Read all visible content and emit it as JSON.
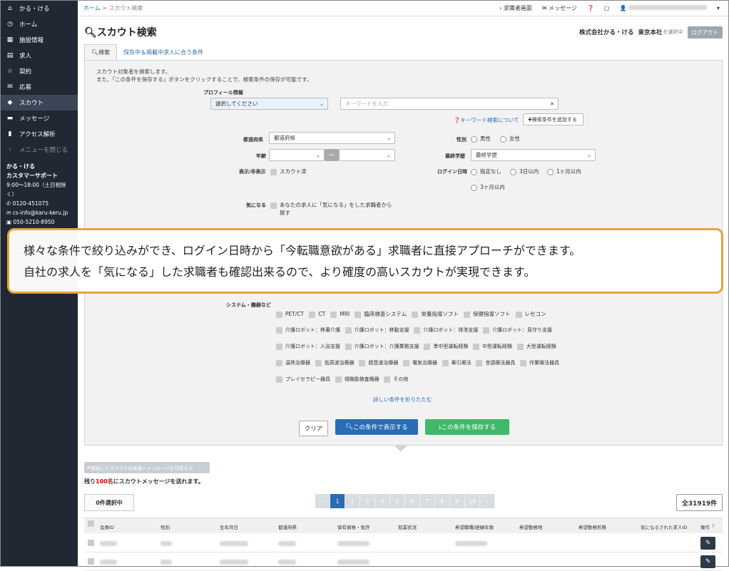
{
  "sidebar": {
    "brand": "かる・ける",
    "items": [
      {
        "label": "ホーム",
        "icon": "clock-icon"
      },
      {
        "label": "施設情報",
        "icon": "grid-icon"
      },
      {
        "label": "求人",
        "icon": "list-icon"
      },
      {
        "label": "契約",
        "icon": "star-icon"
      },
      {
        "label": "応募",
        "icon": "mail-icon"
      },
      {
        "label": "スカウト",
        "icon": "diamond-icon"
      },
      {
        "label": "メッセージ",
        "icon": "chat-icon"
      },
      {
        "label": "アクセス解析",
        "icon": "bar-chart-icon"
      }
    ],
    "close_menu": "メニューを閉じる",
    "support_title": "かる・ける\nカスタマーサポート",
    "support_title1": "かる・ける",
    "support_title2": "カスタマーサポート",
    "support_hours": "9:00～18:00（土日祝除く）",
    "phone": "0120-451075",
    "email": "cs-info@karu-keru.jp",
    "fax": "050-5210-8950"
  },
  "topbar": {
    "crumb_home": "ホーム",
    "crumb_sep": ">",
    "crumb_current": "スカウト検索",
    "jobseeker_screen": "求職者画面",
    "message": "メッセージ"
  },
  "header": {
    "title": "スカウト検索",
    "company": "株式会社かる・ける",
    "branch": "東京本社",
    "selecting": "を選択中",
    "logout": "ログアウト"
  },
  "tabs": [
    {
      "label": "検索"
    },
    {
      "label": "保存中＆掲載中求人に合う条件"
    }
  ],
  "form": {
    "desc1": "スカウト対象者を検索します。",
    "desc2": "また、「この条件を保存する」ボタンをクリックすることで、検索条件の保存が可能です。",
    "profile_label": "プロフィール情報",
    "profile_select": "選択してください",
    "keyword_placeholder": "キーワードを入力",
    "keyword_help": "キーワード検索について",
    "add_condition": "検索条件を追加する",
    "pref_label": "都道府県",
    "pref_select": "都道府県",
    "gender_label": "性別",
    "gender_male": "男性",
    "gender_female": "女性",
    "age_label": "年齢",
    "age_sep": "～",
    "edu_label": "最終学歴",
    "edu_select": "最終学歴",
    "display_label": "表示/非表示",
    "scouted": "スカウト済",
    "login_label": "ログイン日時",
    "login_opts": [
      "指定なし",
      "3日以内",
      "1ヶ月以内",
      "3ヶ月以内"
    ],
    "interest_label": "気になる",
    "interest_text1": "あなたの求人に「気になる」をした求職者から",
    "interest_text2": "探す",
    "system_label": "システム・機器など",
    "equipment": [
      [
        "PET/CT",
        "CT",
        "MRI",
        "臨床検査システム",
        "栄養指導ソフト",
        "保健指導ソフト",
        "レセコン"
      ],
      [
        "介護ロボット：移乗介護",
        "介護ロボット：移動支援",
        "介護ロボット：排泄支援",
        "介護ロボット：見守り支援"
      ],
      [
        "介護ロボット：入浴支援",
        "介護ロボット：介護業務支援",
        "準中型運転経験",
        "中型運転経験",
        "大型運転経験"
      ],
      [
        "温熱治療器",
        "低周波治療器",
        "超音波治療器",
        "電気治療器",
        "牽引療法",
        "言語療法器具",
        "作業療法器具"
      ],
      [
        "プレイセラピー器具",
        "視機能検査機器",
        "その他"
      ]
    ],
    "collapse": "詳しい条件を折りたたむ",
    "clear": "クリア",
    "show": "この条件で表示する",
    "save": "この条件を保存する"
  },
  "callout": {
    "line1": "様々な条件で絞り込みができ、ログイン日時から「今転職意欲がある」求職者に直接アプローチができます。",
    "line2": "自社の求人を「気になる」した求職者も確認出来るので、より確度の高いスカウトが実現できます。"
  },
  "results": {
    "send_button": "選択したスカウト対象者へメッセージを作成する",
    "remain_prefix": "残り",
    "remain_count": "100名",
    "remain_suffix": "にスカウトメッセージを送れます。",
    "selected": "0件選択中",
    "pages": [
      "‹",
      "1",
      "2",
      "3",
      "4",
      "5",
      "6",
      "7",
      "8",
      "9",
      "10",
      "›"
    ],
    "total": "全31919件",
    "columns": [
      "会員ID",
      "性別",
      "生年月日",
      "都道府県",
      "保有資格・免許",
      "就業状況",
      "希望職種/経験年数",
      "希望勤務地",
      "希望勤務形態",
      "気になるされた求人ID",
      "操作"
    ]
  },
  "colors": {
    "sidebar_bg": "#1f2833",
    "accent_blue": "#2a6cb6",
    "save_green": "#3fb86a",
    "callout_border": "#e8a23a",
    "remain_red": "#dd0000"
  }
}
